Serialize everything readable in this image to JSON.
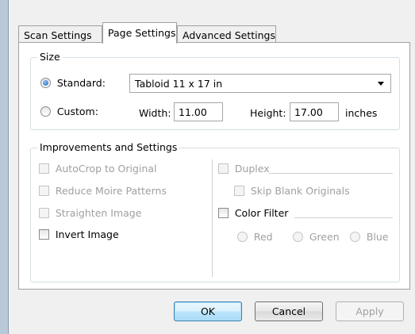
{
  "tabs": [
    {
      "label": "Scan Settings"
    },
    {
      "label": "Page Settings",
      "active": true
    },
    {
      "label": "Advanced Settings"
    }
  ],
  "size_group": {
    "legend": "Size",
    "standard_label": "Standard:",
    "standard_selected": true,
    "standard_value": "Tabloid 11 x 17 in",
    "custom_label": "Custom:",
    "width_label": "Width:",
    "width_value": "11.00",
    "height_label": "Height:",
    "height_value": "17.00",
    "units_label": "inches"
  },
  "improvements_group": {
    "legend": "Improvements and Settings",
    "autocrop": "AutoCrop to Original",
    "reduce_moire": "Reduce Moire Patterns",
    "straighten": "Straighten Image",
    "invert": "Invert Image",
    "duplex": "Duplex",
    "skip_blank": "Skip Blank Originals",
    "color_filter": "Color Filter",
    "red": "Red",
    "green": "Green",
    "blue": "Blue"
  },
  "buttons": {
    "ok": "OK",
    "cancel": "Cancel",
    "apply": "Apply"
  },
  "colors": {
    "accent": "#3c7fb1",
    "disabled_text": "#a0a0a0"
  }
}
